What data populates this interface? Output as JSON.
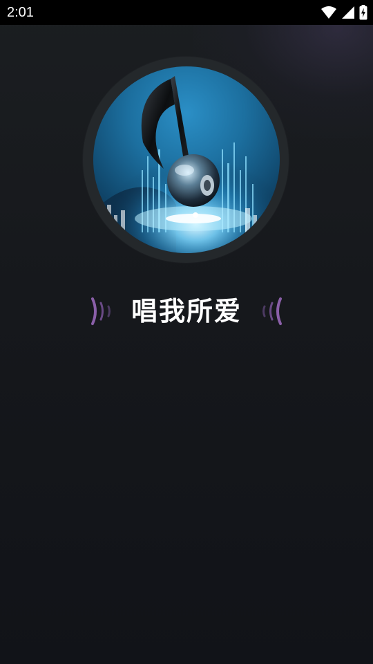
{
  "status_bar": {
    "time": "2:01",
    "icons": [
      "wifi-icon",
      "cellular-signal-icon",
      "battery-charging-icon"
    ]
  },
  "cover": {
    "icon": "music-note-artwork",
    "colors": {
      "ring": "#24282b",
      "art_primary": "#1c6f9f",
      "art_glow": "#7fd8ff"
    }
  },
  "app": {
    "title": "唱我所爱",
    "wave_color": "#8a5fa8"
  }
}
